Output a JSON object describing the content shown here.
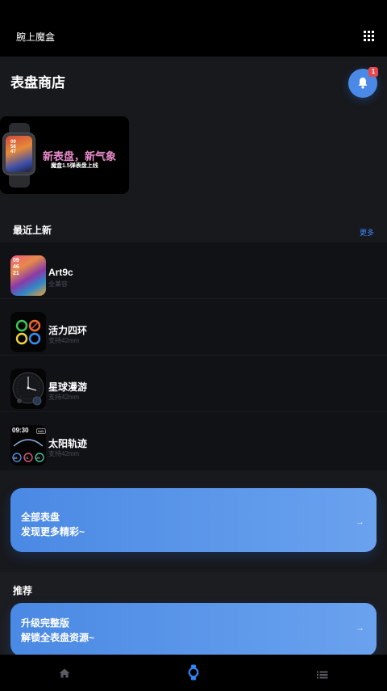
{
  "app": {
    "title": "腕上魔盒"
  },
  "header": {
    "title": "表盘商店",
    "notification_count": "1"
  },
  "banner": {
    "title": "新表盘，新气象",
    "subtitle": "魔盒1.5弹表盘上线",
    "watch_time": [
      "09",
      "58",
      "47"
    ]
  },
  "recent": {
    "title": "最近上新",
    "more_label": "更多",
    "items": [
      {
        "name": "Art9c",
        "sub": "全兼容",
        "thumb_time": [
          "09",
          "46",
          "21"
        ]
      },
      {
        "name": "活力四环",
        "sub": "支持42mm"
      },
      {
        "name": "星球漫游",
        "sub": "支持42mm"
      },
      {
        "name": "太阳轨迹",
        "sub": "支持42mm",
        "thumb_time": "09:30",
        "thumb_tag": "NAV",
        "thumb_dials": [
          "56",
          "71",
          "29"
        ]
      }
    ]
  },
  "all_faces": {
    "line1": "全部表盘",
    "line2": "发现更多精彩~",
    "arrow": "→"
  },
  "recommend": {
    "title": "推荐",
    "line1": "升级完整版",
    "line2": "解锁全表盘资源~",
    "arrow": "→"
  },
  "nav": {
    "items": [
      {
        "icon": "home-icon"
      },
      {
        "icon": "watch-icon",
        "active": true
      },
      {
        "icon": "list-icon"
      }
    ]
  },
  "colors": {
    "accent": "#4a8ae6",
    "link": "#3d8aff",
    "badge": "#e5484d",
    "banner_title": "#e98acb"
  }
}
